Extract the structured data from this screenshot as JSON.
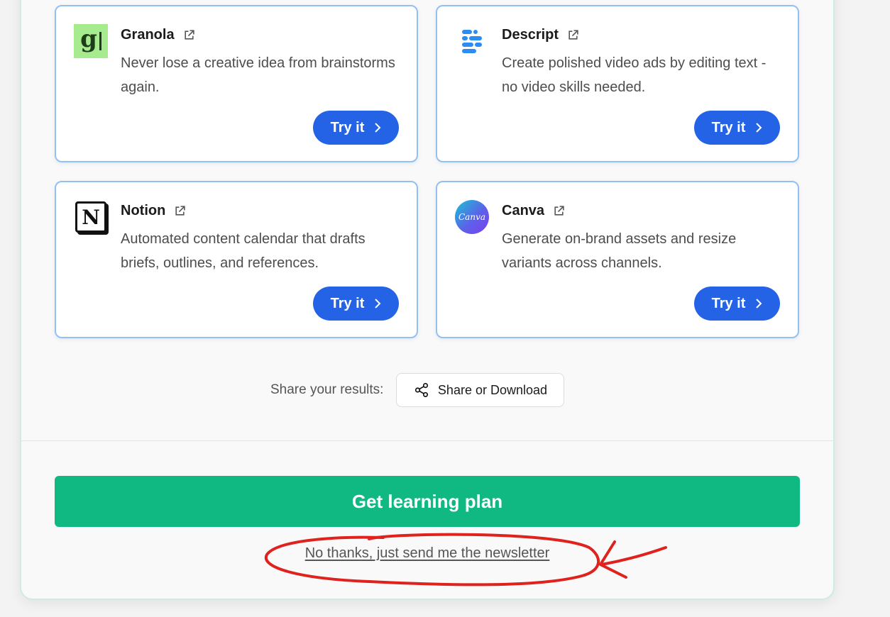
{
  "tools": [
    {
      "name": "Granola",
      "description": "Never lose a creative idea from brainstorms again.",
      "cta": "Try it",
      "logo_glyph": "g",
      "icon": "granola-logo"
    },
    {
      "name": "Descript",
      "description": "Create polished video ads by editing text - no video skills needed.",
      "cta": "Try it",
      "icon": "descript-logo"
    },
    {
      "name": "Notion",
      "description": "Automated content calendar that drafts briefs, outlines, and references.",
      "cta": "Try it",
      "logo_glyph": "N",
      "icon": "notion-logo"
    },
    {
      "name": "Canva",
      "description": "Generate on-brand assets and resize variants across channels.",
      "cta": "Try it",
      "logo_glyph": "Canva",
      "icon": "canva-logo"
    }
  ],
  "share": {
    "label": "Share your results:",
    "button": "Share or Download"
  },
  "main_cta": "Get learning plan",
  "newsletter_link": "No thanks, just send me the newsletter",
  "colors": {
    "primary_blue": "#2563e6",
    "green": "#10b981",
    "card_border": "#93c0f4",
    "annotation_red": "#e0221e"
  }
}
